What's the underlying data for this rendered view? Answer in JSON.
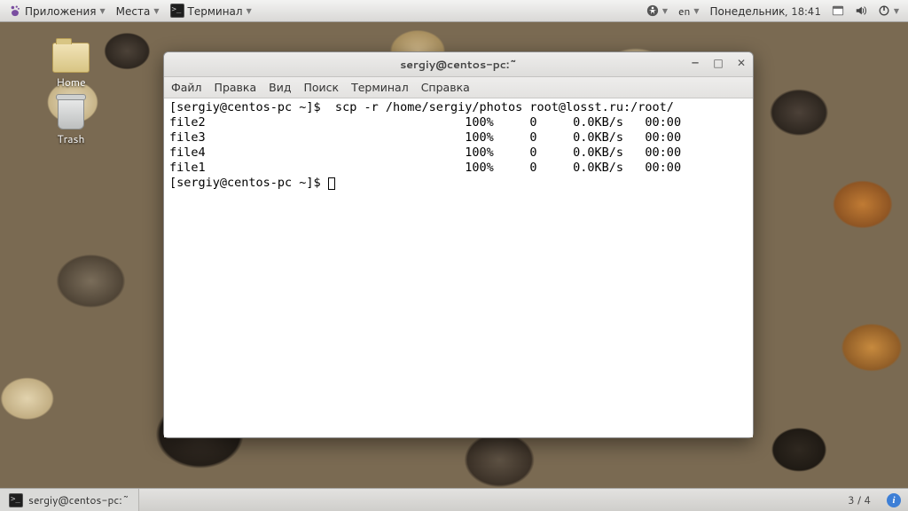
{
  "top_panel": {
    "apps_label": "Приложения",
    "places_label": "Места",
    "terminal_label": "Терминал",
    "accessibility_icon": "accessibility",
    "layout": "en",
    "datetime": "Понедельник, 18:41",
    "icons": [
      "accessibility",
      "keyboard-layout",
      "calendar",
      "volume",
      "power"
    ]
  },
  "desktop": {
    "home_label": "Home",
    "trash_label": "Trash"
  },
  "window": {
    "title": "sergiy@centos-pc:~",
    "menus": [
      "Файл",
      "Правка",
      "Вид",
      "Поиск",
      "Терминал",
      "Справка"
    ]
  },
  "terminal": {
    "prompt1": "[sergiy@centos-pc ~]$ ",
    "command": " scp -r /home/sergiy/photos root@losst.ru:/root/",
    "rows": [
      {
        "name": "file2",
        "pct": "100%",
        "size": "0",
        "rate": "0.0KB/s",
        "time": "00:00"
      },
      {
        "name": "file3",
        "pct": "100%",
        "size": "0",
        "rate": "0.0KB/s",
        "time": "00:00"
      },
      {
        "name": "file4",
        "pct": "100%",
        "size": "0",
        "rate": "0.0KB/s",
        "time": "00:00"
      },
      {
        "name": "file1",
        "pct": "100%",
        "size": "0",
        "rate": "0.0KB/s",
        "time": "00:00"
      }
    ],
    "prompt2": "[sergiy@centos-pc ~]$ "
  },
  "bottom_panel": {
    "task_label": "sergiy@centos-pc:~",
    "workspace": "3 / 4"
  }
}
